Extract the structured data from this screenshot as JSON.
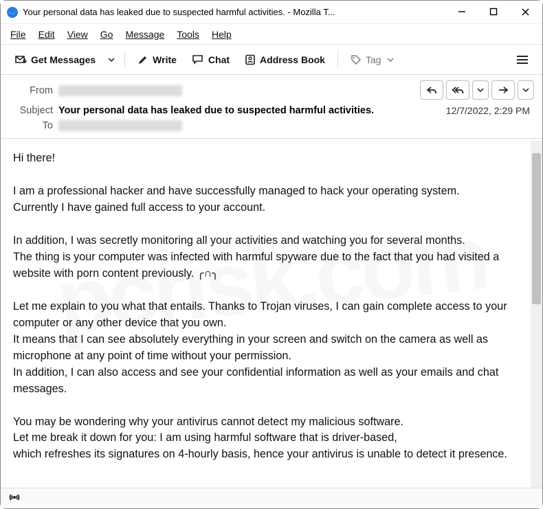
{
  "window": {
    "title": "Your personal data has leaked due to suspected harmful activities. - Mozilla T..."
  },
  "menu": {
    "file": "File",
    "edit": "Edit",
    "view": "View",
    "go": "Go",
    "message": "Message",
    "tools": "Tools",
    "help": "Help"
  },
  "toolbar": {
    "get_messages": "Get Messages",
    "write": "Write",
    "chat": "Chat",
    "address_book": "Address Book",
    "tag": "Tag"
  },
  "header": {
    "from_label": "From",
    "subject_label": "Subject",
    "to_label": "To",
    "subject_value": "Your personal data has leaked due to suspected harmful activities.",
    "date": "12/7/2022, 2:29 PM"
  },
  "body": "Hi there!\n\nI am a professional hacker and have successfully managed to hack your operating system.\nCurrently I have gained full access to your account.\n\nIn addition, I was secretly monitoring all your activities and watching you for several months.\nThe thing is your computer was infected with harmful spyware due to the fact that you had visited a website with porn content previously. ╭∩╮\n\nLet me explain to you what that entails. Thanks to Trojan viruses, I can gain complete access to your computer or any other device that you own.\nIt means that I can see absolutely everything in your screen and switch on the camera as well as microphone at any point of time without your permission.\nIn addition, I can also access and see your confidential information as well as your emails and chat messages.\n\nYou may be wondering why your antivirus cannot detect my malicious software.\nLet me break it down for you: I am using harmful software that is driver-based,\nwhich refreshes its signatures on 4-hourly basis, hence your antivirus is unable to detect it presence.",
  "watermark": "pcrisk.com"
}
